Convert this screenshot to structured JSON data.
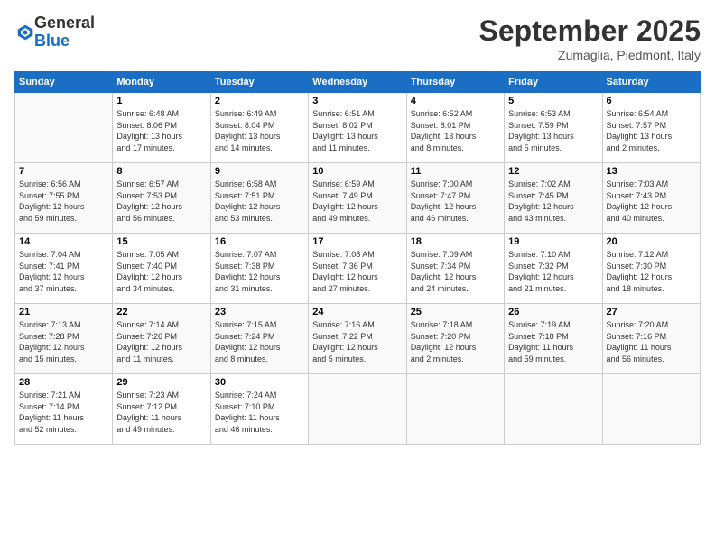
{
  "logo": {
    "general": "General",
    "blue": "Blue"
  },
  "title": "September 2025",
  "subtitle": "Zumaglia, Piedmont, Italy",
  "headers": [
    "Sunday",
    "Monday",
    "Tuesday",
    "Wednesday",
    "Thursday",
    "Friday",
    "Saturday"
  ],
  "weeks": [
    [
      {
        "day": "",
        "info": ""
      },
      {
        "day": "1",
        "info": "Sunrise: 6:48 AM\nSunset: 8:06 PM\nDaylight: 13 hours\nand 17 minutes."
      },
      {
        "day": "2",
        "info": "Sunrise: 6:49 AM\nSunset: 8:04 PM\nDaylight: 13 hours\nand 14 minutes."
      },
      {
        "day": "3",
        "info": "Sunrise: 6:51 AM\nSunset: 8:02 PM\nDaylight: 13 hours\nand 11 minutes."
      },
      {
        "day": "4",
        "info": "Sunrise: 6:52 AM\nSunset: 8:01 PM\nDaylight: 13 hours\nand 8 minutes."
      },
      {
        "day": "5",
        "info": "Sunrise: 6:53 AM\nSunset: 7:59 PM\nDaylight: 13 hours\nand 5 minutes."
      },
      {
        "day": "6",
        "info": "Sunrise: 6:54 AM\nSunset: 7:57 PM\nDaylight: 13 hours\nand 2 minutes."
      }
    ],
    [
      {
        "day": "7",
        "info": "Sunrise: 6:56 AM\nSunset: 7:55 PM\nDaylight: 12 hours\nand 59 minutes."
      },
      {
        "day": "8",
        "info": "Sunrise: 6:57 AM\nSunset: 7:53 PM\nDaylight: 12 hours\nand 56 minutes."
      },
      {
        "day": "9",
        "info": "Sunrise: 6:58 AM\nSunset: 7:51 PM\nDaylight: 12 hours\nand 53 minutes."
      },
      {
        "day": "10",
        "info": "Sunrise: 6:59 AM\nSunset: 7:49 PM\nDaylight: 12 hours\nand 49 minutes."
      },
      {
        "day": "11",
        "info": "Sunrise: 7:00 AM\nSunset: 7:47 PM\nDaylight: 12 hours\nand 46 minutes."
      },
      {
        "day": "12",
        "info": "Sunrise: 7:02 AM\nSunset: 7:45 PM\nDaylight: 12 hours\nand 43 minutes."
      },
      {
        "day": "13",
        "info": "Sunrise: 7:03 AM\nSunset: 7:43 PM\nDaylight: 12 hours\nand 40 minutes."
      }
    ],
    [
      {
        "day": "14",
        "info": "Sunrise: 7:04 AM\nSunset: 7:41 PM\nDaylight: 12 hours\nand 37 minutes."
      },
      {
        "day": "15",
        "info": "Sunrise: 7:05 AM\nSunset: 7:40 PM\nDaylight: 12 hours\nand 34 minutes."
      },
      {
        "day": "16",
        "info": "Sunrise: 7:07 AM\nSunset: 7:38 PM\nDaylight: 12 hours\nand 31 minutes."
      },
      {
        "day": "17",
        "info": "Sunrise: 7:08 AM\nSunset: 7:36 PM\nDaylight: 12 hours\nand 27 minutes."
      },
      {
        "day": "18",
        "info": "Sunrise: 7:09 AM\nSunset: 7:34 PM\nDaylight: 12 hours\nand 24 minutes."
      },
      {
        "day": "19",
        "info": "Sunrise: 7:10 AM\nSunset: 7:32 PM\nDaylight: 12 hours\nand 21 minutes."
      },
      {
        "day": "20",
        "info": "Sunrise: 7:12 AM\nSunset: 7:30 PM\nDaylight: 12 hours\nand 18 minutes."
      }
    ],
    [
      {
        "day": "21",
        "info": "Sunrise: 7:13 AM\nSunset: 7:28 PM\nDaylight: 12 hours\nand 15 minutes."
      },
      {
        "day": "22",
        "info": "Sunrise: 7:14 AM\nSunset: 7:26 PM\nDaylight: 12 hours\nand 11 minutes."
      },
      {
        "day": "23",
        "info": "Sunrise: 7:15 AM\nSunset: 7:24 PM\nDaylight: 12 hours\nand 8 minutes."
      },
      {
        "day": "24",
        "info": "Sunrise: 7:16 AM\nSunset: 7:22 PM\nDaylight: 12 hours\nand 5 minutes."
      },
      {
        "day": "25",
        "info": "Sunrise: 7:18 AM\nSunset: 7:20 PM\nDaylight: 12 hours\nand 2 minutes."
      },
      {
        "day": "26",
        "info": "Sunrise: 7:19 AM\nSunset: 7:18 PM\nDaylight: 11 hours\nand 59 minutes."
      },
      {
        "day": "27",
        "info": "Sunrise: 7:20 AM\nSunset: 7:16 PM\nDaylight: 11 hours\nand 56 minutes."
      }
    ],
    [
      {
        "day": "28",
        "info": "Sunrise: 7:21 AM\nSunset: 7:14 PM\nDaylight: 11 hours\nand 52 minutes."
      },
      {
        "day": "29",
        "info": "Sunrise: 7:23 AM\nSunset: 7:12 PM\nDaylight: 11 hours\nand 49 minutes."
      },
      {
        "day": "30",
        "info": "Sunrise: 7:24 AM\nSunset: 7:10 PM\nDaylight: 11 hours\nand 46 minutes."
      },
      {
        "day": "",
        "info": ""
      },
      {
        "day": "",
        "info": ""
      },
      {
        "day": "",
        "info": ""
      },
      {
        "day": "",
        "info": ""
      }
    ]
  ]
}
